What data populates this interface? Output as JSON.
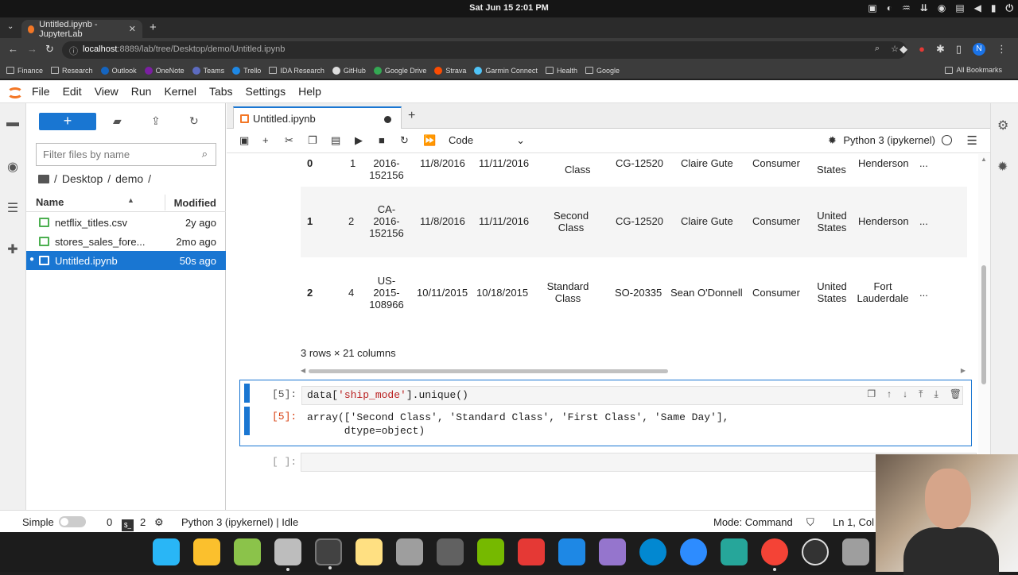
{
  "system": {
    "clock": "Sat Jun 15  2:01 PM"
  },
  "browser": {
    "tab_title": "Untitled.ipynb - JupyterLab",
    "url_host": "localhost",
    "url_path": ":8889/lab/tree/Desktop/demo/Untitled.ipynb",
    "profile_initial": "N",
    "bookmarks": [
      "Finance",
      "Research",
      "Outlook",
      "OneNote",
      "Teams",
      "Trello",
      "IDA Research",
      "GitHub",
      "Google Drive",
      "Strava",
      "Garmin Connect",
      "Health",
      "Google"
    ],
    "all_bookmarks": "All Bookmarks"
  },
  "menu": [
    "File",
    "Edit",
    "View",
    "Run",
    "Kernel",
    "Tabs",
    "Settings",
    "Help"
  ],
  "file_browser": {
    "filter_placeholder": "Filter files by name",
    "breadcrumb": [
      "/",
      "Desktop",
      "/",
      "demo",
      "/"
    ],
    "col_name": "Name",
    "col_modified": "Modified",
    "files": [
      {
        "name": "netflix_titles.csv",
        "modified": "2y ago"
      },
      {
        "name": "stores_sales_fore...",
        "modified": "2mo ago"
      },
      {
        "name": "Untitled.ipynb",
        "modified": "50s ago"
      }
    ]
  },
  "notebook": {
    "tab_title": "Untitled.ipynb",
    "cell_type": "Code",
    "kernel": "Python 3 (ipykernel)",
    "table_rows": [
      {
        "idx": "0",
        "c1": "1",
        "c2": "2016-\n152156",
        "c3": "11/8/2016",
        "c4": "11/11/2016",
        "c5": "Class",
        "c6": "CG-12520",
        "c7": "Claire Gute",
        "c8": "Consumer",
        "c9": "States",
        "c10": "Henderson",
        "c11": "..."
      },
      {
        "idx": "1",
        "c1": "2",
        "c2": "CA-\n2016-\n152156",
        "c3": "11/8/2016",
        "c4": "11/11/2016",
        "c5": "Second\nClass",
        "c6": "CG-12520",
        "c7": "Claire Gute",
        "c8": "Consumer",
        "c9": "United\nStates",
        "c10": "Henderson",
        "c11": "..."
      },
      {
        "idx": "2",
        "c1": "4",
        "c2": "US-\n2015-\n108966",
        "c3": "10/11/2015",
        "c4": "10/18/2015",
        "c5": "Standard\nClass",
        "c6": "SO-20335",
        "c7": "Sean O'Donnell",
        "c8": "Consumer",
        "c9": "United\nStates",
        "c10": "Fort\nLauderdale",
        "c11": "..."
      }
    ],
    "shape": "3 rows × 21 columns",
    "cell5_prompt": "[5]:",
    "cell5_code_prefix": "data[",
    "cell5_code_string": "'ship_mode'",
    "cell5_code_suffix": "].unique()",
    "cell5_out_prompt": "[5]:",
    "cell5_output": "array(['Second Class', 'Standard Class', 'First Class', 'Same Day'],\n      dtype=object)",
    "empty_prompt": "[ ]:"
  },
  "status": {
    "mode_label": "Simple",
    "terminals": "0",
    "kernels": "2",
    "kernel_status": "Python 3 (ipykernel) | Idle",
    "command_mode": "Mode: Command",
    "cursor": "Ln 1, Col 1"
  }
}
